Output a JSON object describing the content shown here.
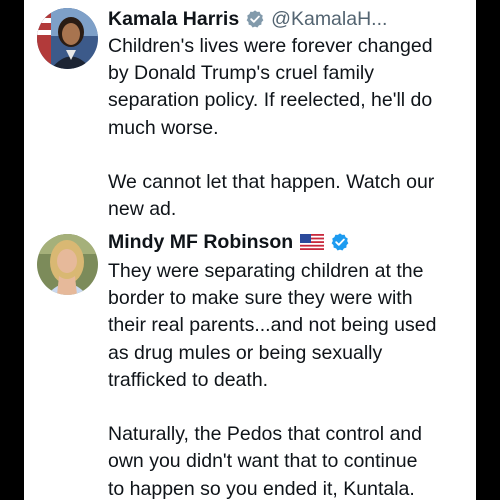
{
  "posts": [
    {
      "author": "Kamala Harris",
      "handle": "@KamalaH...",
      "verified": true,
      "lines": [
        "Children's lives were forever changed",
        "by Donald Trump's cruel family",
        "separation policy. If reelected, he'll do",
        "much worse.",
        "",
        "We cannot let that happen. Watch our",
        "new ad."
      ]
    },
    {
      "author": "Mindy MF Robinson",
      "flag": "us-flag-emoji",
      "verified": true,
      "lines": [
        "They were separating children at the",
        "border to make sure they were with",
        "their real parents...and not being used",
        "as drug mules or being sexually",
        "trafficked to death.",
        "",
        "Naturally, the Pedos that control and",
        "own you didn't want that to continue",
        "to happen so you ended it, Kuntala."
      ]
    }
  ],
  "colors": {
    "background": "#000000",
    "card": "#ffffff",
    "text": "#0f1419",
    "handle": "#536471",
    "verified": "#1d9bf0"
  }
}
